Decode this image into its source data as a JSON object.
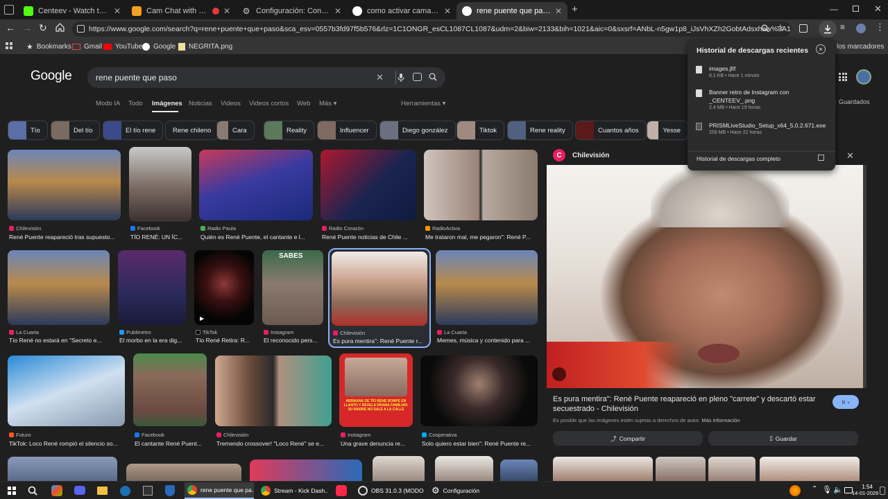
{
  "browser": {
    "tabs": [
      {
        "title": "Centeev - Watch the VOD on K",
        "active": false
      },
      {
        "title": "Cam Chat with Strangers on",
        "active": false
      },
      {
        "title": "Configuración: Configuración d",
        "active": false
      },
      {
        "title": "como activar camara ometv - B",
        "active": false
      },
      {
        "title": "rene puente que paso - Buscar",
        "active": true
      }
    ],
    "new_tab_symbol": "+",
    "url": "https://www.google.com/search?q=rene+puente+que+paso&sca_esv=0557b3fd97f5b576&rlz=1C1ONGR_esCL1087CL1087&udm=2&biw=2133&bih=1021&aic=0&sxsrf=ANbL-n5gw1p8_iJsVhXZh2GobtAdsxhaw%3A1768366359...",
    "bookmarks": [
      {
        "label": "Bookmarks",
        "icon": "star-icon"
      },
      {
        "label": "Gmail",
        "icon": "gmail-icon"
      },
      {
        "label": "YouTube",
        "icon": "youtube-icon"
      },
      {
        "label": "Google",
        "icon": "google-icon"
      },
      {
        "label": "NEGRITA.png",
        "icon": "image-file-icon"
      }
    ],
    "bookmarks_right": "los marcadores"
  },
  "google": {
    "logo": "Google",
    "query": "rene puente que paso",
    "nav_tabs": [
      "Modo IA",
      "Todo",
      "Imágenes",
      "Noticias",
      "Videos",
      "Videos cortos",
      "Web",
      "Más"
    ],
    "selected_tab": "Imágenes",
    "tools": "Herramientas",
    "saved": "Guardados",
    "chips": [
      "Tío",
      "Del tío",
      "El tío rene",
      "Rene chileno",
      "Cara",
      "Reality",
      "Influencer",
      "Diego gonzález",
      "Tiktok",
      "Rene reality",
      "Cuantos años",
      "Yesse"
    ],
    "results": [
      {
        "source": "Chilevisión",
        "caption": "René Puente reapareció tras supuesto..."
      },
      {
        "source": "Facebook",
        "caption": "TÍO RENÉ: UN ÍC..."
      },
      {
        "source": "Radio Paula",
        "caption": "Quién es René Puente, el cantante e l..."
      },
      {
        "source": "Radio Corazón",
        "caption": "René Puente noticias de Chile ..."
      },
      {
        "source": "RadioActiva",
        "caption": "Me trataron mal, me pegaron\": René P..."
      },
      {
        "source": "La Cuarta",
        "caption": "Tío René no estará en \"Secreto e..."
      },
      {
        "source": "Publimetro",
        "caption": "El morbo en la era dig..."
      },
      {
        "source": "TikTok",
        "caption": "Tío René Retira: R..."
      },
      {
        "source": "Instagram",
        "caption": "El reconocido pers...",
        "overlay": "SABES"
      },
      {
        "source": "Chilevisión",
        "caption": "Es pura mentira\": René Puente r..."
      },
      {
        "source": "La Cuarta",
        "caption": "Memes, música y contenido para ..."
      },
      {
        "source": "Futuro",
        "caption": "TikTok: Loco René rompió el silencio so..."
      },
      {
        "source": "Facebook",
        "caption": "El cantante René Puent..."
      },
      {
        "source": "Chilevisión",
        "caption": "Tremendo crossover! \"Loco René\" se e..."
      },
      {
        "source": "Instagram",
        "caption": "Una grave denuncia re...",
        "overlay": "HERMANA DE TÍO RENE ROMPE EN LLANTO Y REVELA DRAMA FAMILIAR: SU MADRE NO SALE A LA CALLE"
      },
      {
        "source": "Cooperativa",
        "caption": "Solo quiero estar bien\": René Puente re..."
      }
    ],
    "panel": {
      "source": "Chilevisión",
      "title": "Es pura mentira\": René Puente reapareció en pleno \"carrete\" y descartó estar secuestrado - Chilevisión",
      "go_label": "Ir",
      "copyright": "Es posible que las imágenes estén sujetas a derechos de autor.",
      "more_info": "Más información",
      "share_label": "Compartir",
      "save_label": "Guardar"
    }
  },
  "downloads": {
    "title": "Historial de descargas recientes",
    "items": [
      {
        "name": "images.jfif",
        "meta": "8,1 KB • Hace 1 minuto"
      },
      {
        "name": "Banner retro de Instagram con _CENTEEV_.png",
        "meta": "2,4 MB • Hace 19 horas"
      },
      {
        "name": "PRISMLiveStudio_Setup_x64_5.0.2.671.exe",
        "meta": "259 MB • Hace 22 horas"
      }
    ],
    "footer": "Historial de descargas completo"
  },
  "taskbar": {
    "apps": [
      {
        "label": "rene puente que pa...",
        "active": true
      },
      {
        "label": "Stream - Kick Dash...",
        "active": false
      },
      {
        "label": "OBS 31.0.3 (MODO ...",
        "active": false
      },
      {
        "label": "Configuración",
        "active": false
      }
    ],
    "time": "1:54",
    "date": "14-01-2026"
  },
  "colors": {
    "accent": "#8ab4f8",
    "selected_border": "#8ab4f8",
    "go_button": "#8ab4f8"
  }
}
